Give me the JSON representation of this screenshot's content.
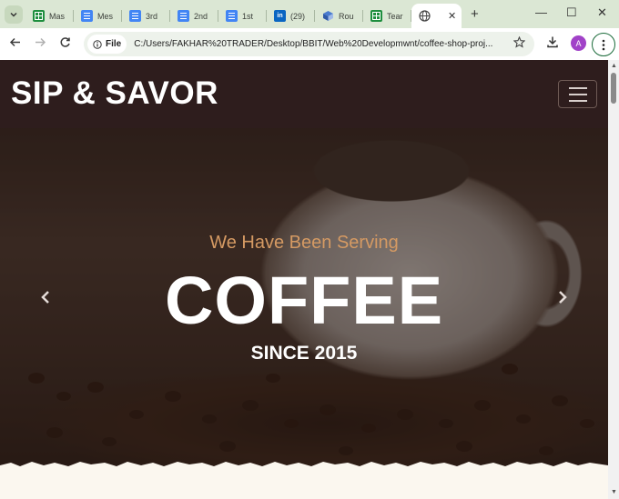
{
  "browser": {
    "tabs": [
      {
        "label": "Mas",
        "icon": "sheets-icon"
      },
      {
        "label": "Mes",
        "icon": "docs-icon"
      },
      {
        "label": "3rd",
        "icon": "docs-icon"
      },
      {
        "label": "2nd",
        "icon": "docs-icon"
      },
      {
        "label": "1st",
        "icon": "docs-icon"
      },
      {
        "label": "(29)",
        "icon": "linkedin-icon"
      },
      {
        "label": "Rou",
        "icon": "cube-icon"
      },
      {
        "label": "Tear",
        "icon": "sheets-icon"
      }
    ],
    "active_tab": {
      "icon": "globe-icon",
      "close": "✕"
    },
    "new_tab": "+",
    "window_controls": {
      "minimize": "—",
      "maximize": "☐",
      "close": "✕"
    },
    "address": {
      "chip_label": "File",
      "url": "C:/Users/FAKHAR%20TRADER/Desktop/BBIT/Web%20Developmwnt/coffee-shop-proj..."
    },
    "profile_initial": "A",
    "linkedin_badge": "in",
    "colors": {
      "frame": "#dbe7d4",
      "omnibox": "#edf2eb",
      "profile": "#a142c8"
    }
  },
  "site": {
    "brand": "SIP & SAVOR",
    "hero": {
      "eyebrow": "We Have Been Serving",
      "headline": "COFFEE",
      "subline": "SINCE 2015"
    },
    "colors": {
      "navbar": "#2e1d1d",
      "accent": "#d59a63",
      "page": "#fbf7ef"
    }
  }
}
